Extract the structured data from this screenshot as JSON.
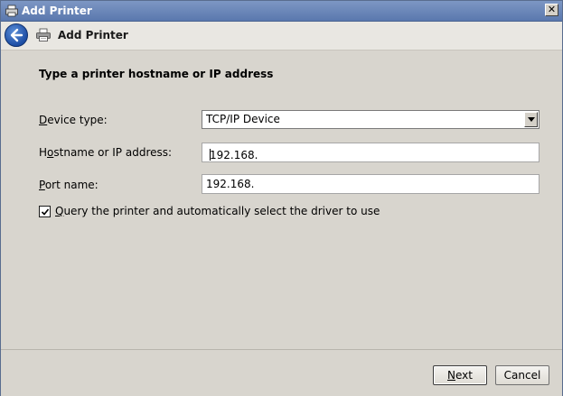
{
  "window": {
    "title": "Add Printer",
    "close_glyph": "✕"
  },
  "nav": {
    "title": "Add Printer"
  },
  "content": {
    "heading": "Type a printer hostname or IP address",
    "device_type": {
      "label_underlined": "D",
      "label_rest": "evice type:",
      "value": "TCP/IP Device"
    },
    "hostname": {
      "label_pre": "H",
      "label_underlined": "o",
      "label_rest": "stname or IP address:",
      "value": "192.168."
    },
    "port": {
      "label_underlined": "P",
      "label_rest": "ort name:",
      "value": "192.168."
    },
    "query_checkbox": {
      "label_underlined": "Q",
      "label_rest": "uery the printer and automatically select the driver to use",
      "checked": true
    }
  },
  "footer": {
    "next_underlined": "N",
    "next_rest": "ext",
    "cancel_label": "Cancel"
  },
  "icons": {
    "title": "printer-icon",
    "back": "back-arrow-icon",
    "nav": "printer-icon"
  }
}
